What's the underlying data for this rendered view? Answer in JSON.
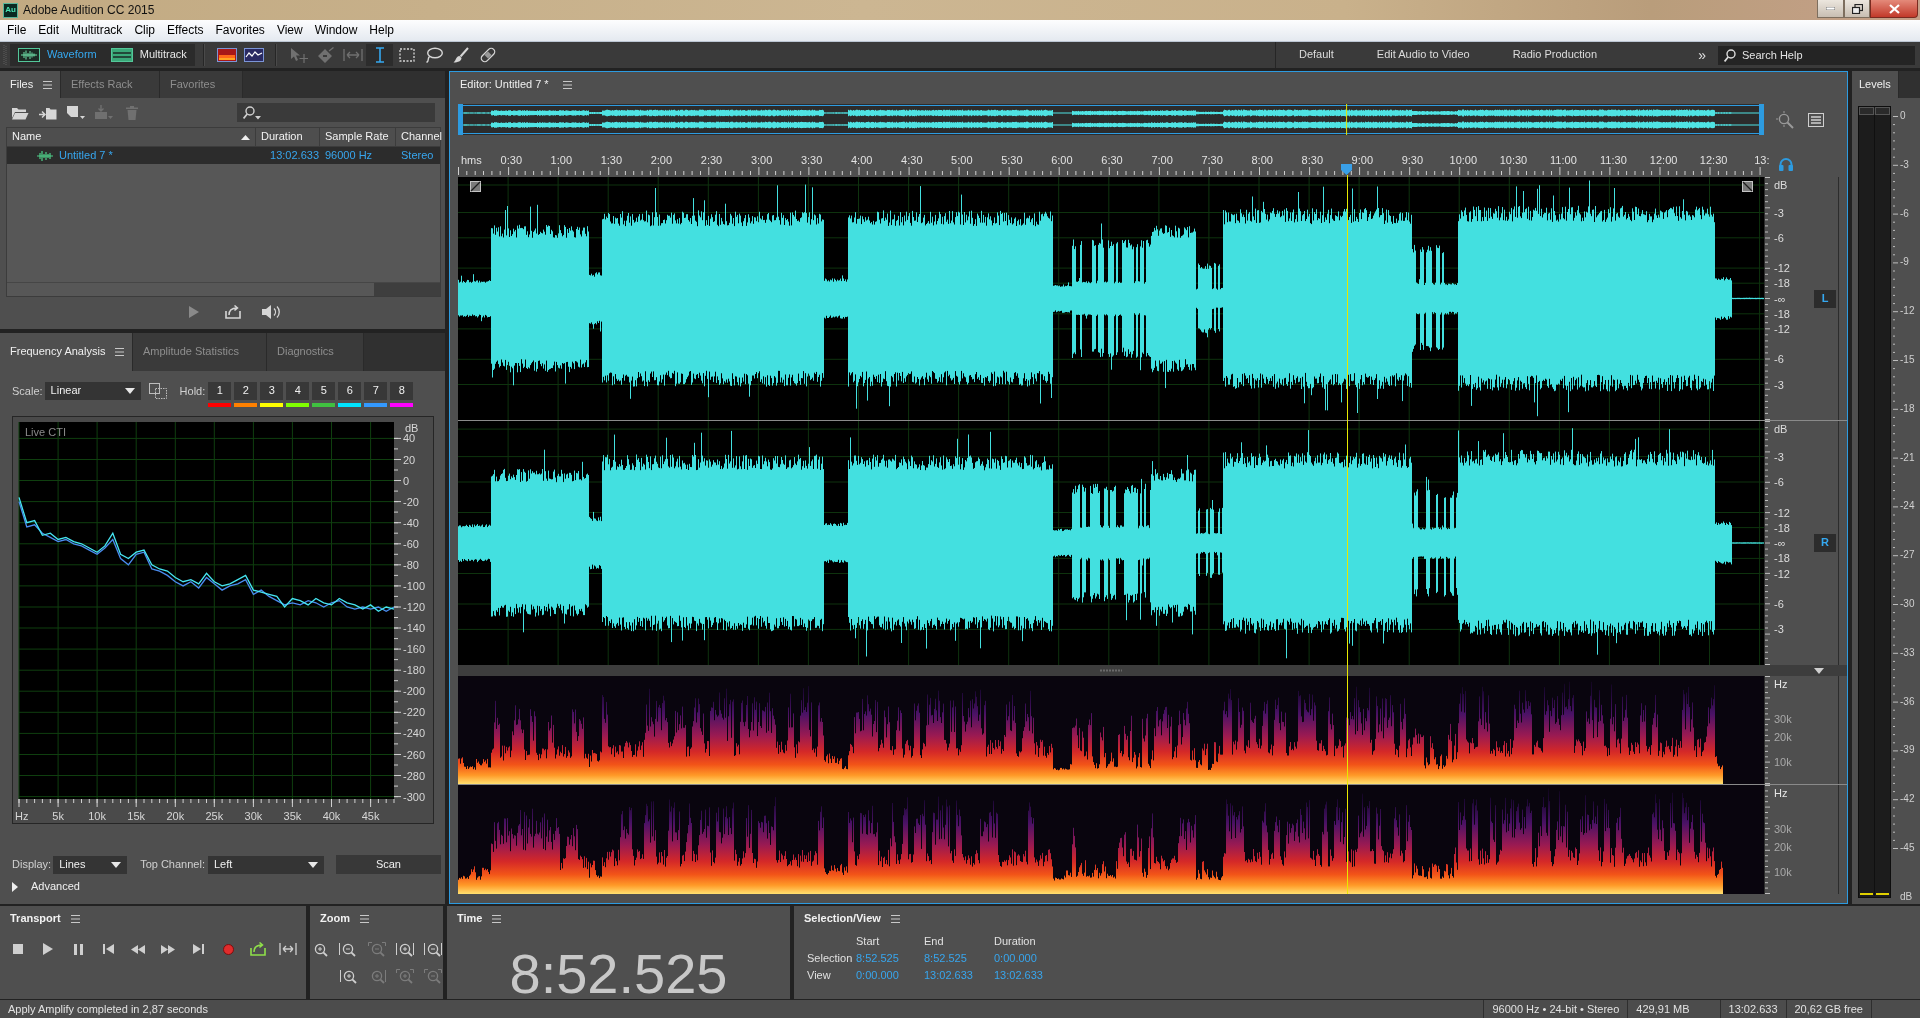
{
  "window": {
    "logo": "Au",
    "title": "Adobe Audition CC 2015"
  },
  "menu": [
    "File",
    "Edit",
    "Multitrack",
    "Clip",
    "Effects",
    "Favorites",
    "View",
    "Window",
    "Help"
  ],
  "toolbar": {
    "views": [
      {
        "kind": "waveform",
        "label": "Waveform",
        "selected": true
      },
      {
        "kind": "multitrack",
        "label": "Multitrack",
        "selected": false
      }
    ],
    "display_buttons": [
      {
        "kind": "spectral",
        "selected": false
      },
      {
        "kind": "pitch",
        "selected": false
      }
    ],
    "tools": [
      {
        "kind": "move",
        "selected": false,
        "disabled": true
      },
      {
        "kind": "razor",
        "selected": false,
        "disabled": true
      },
      {
        "kind": "slip",
        "selected": false,
        "disabled": true
      },
      {
        "kind": "time-selection",
        "selected": true,
        "disabled": false
      },
      {
        "kind": "marquee",
        "selected": false,
        "disabled": false
      },
      {
        "kind": "lasso",
        "selected": false,
        "disabled": false
      },
      {
        "kind": "brush",
        "selected": false,
        "disabled": false
      },
      {
        "kind": "healing",
        "selected": false,
        "disabled": false
      }
    ],
    "workspaces": [
      "Default",
      "Edit Audio to Video",
      "Radio Production"
    ],
    "overflow": "»",
    "search": {
      "placeholder": "Search Help"
    }
  },
  "files_panel": {
    "tabs": [
      {
        "label": "Files",
        "selected": true
      },
      {
        "label": "Effects Rack",
        "selected": false
      },
      {
        "label": "Favorites",
        "selected": false
      }
    ],
    "tools": [
      {
        "kind": "open",
        "disabled": false
      },
      {
        "kind": "import",
        "disabled": false
      },
      {
        "kind": "new",
        "disabled": false
      },
      {
        "kind": "insert",
        "disabled": true
      },
      {
        "kind": "delete",
        "disabled": true
      }
    ],
    "columns": [
      {
        "label": "Name",
        "sorted": true
      },
      {
        "label": "Duration",
        "sorted": false
      },
      {
        "label": "Sample Rate",
        "sorted": false
      },
      {
        "label": "Channel",
        "sorted": false
      }
    ],
    "rows": [
      {
        "name": "Untitled 7 *",
        "duration": "13:02.633",
        "sample_rate": "96000 Hz",
        "channel": "Stereo",
        "selected": true
      }
    ],
    "preview_buttons": [
      {
        "kind": "play",
        "disabled": true
      },
      {
        "kind": "loop",
        "disabled": false
      },
      {
        "kind": "autoplay",
        "disabled": false
      }
    ]
  },
  "analysis_panel": {
    "tabs": [
      {
        "label": "Frequency Analysis",
        "selected": true
      },
      {
        "label": "Amplitude Statistics",
        "selected": false
      },
      {
        "label": "Diagnostics",
        "selected": false
      }
    ],
    "scale_label": "Scale:",
    "scale": "Linear",
    "hold_label": "Hold:",
    "hold": [
      {
        "label": "1",
        "color": "#ff0000"
      },
      {
        "label": "2",
        "color": "#ff8000"
      },
      {
        "label": "3",
        "color": "#ffff00"
      },
      {
        "label": "4",
        "color": "#80ff00"
      },
      {
        "label": "5",
        "color": "#40c040"
      },
      {
        "label": "6",
        "color": "#00e5ff"
      },
      {
        "label": "7",
        "color": "#3399ff"
      },
      {
        "label": "8",
        "color": "#ff00ff"
      }
    ],
    "chart_data": {
      "type": "line",
      "title": "Live CTI",
      "ylabel": "dB",
      "x": [
        0,
        1000,
        2000,
        3000,
        4000,
        5000,
        6000,
        7000,
        8000,
        9000,
        10000,
        11000,
        12000,
        13000,
        14000,
        15000,
        16000,
        17000,
        18000,
        19000,
        20000,
        21000,
        22000,
        23000,
        24000,
        25000,
        26000,
        27000,
        28000,
        29000,
        30000,
        31000,
        32000,
        33000,
        34000,
        35000,
        36000,
        37000,
        38000,
        39000,
        40000,
        41000,
        42000,
        43000,
        44000,
        45000,
        46000,
        47000,
        48000
      ],
      "series": [
        {
          "color": "#4a8cf0",
          "values": [
            -20,
            -44,
            -42,
            -50,
            -54,
            -58,
            -56,
            -60,
            -62,
            -66,
            -70,
            -64,
            -56,
            -74,
            -80,
            -70,
            -68,
            -84,
            -86,
            -90,
            -96,
            -100,
            -96,
            -102,
            -92,
            -98,
            -104,
            -100,
            -98,
            -94,
            -108,
            -104,
            -110,
            -114,
            -118,
            -116,
            -118,
            -114,
            -116,
            -120,
            -116,
            -114,
            -120,
            -122,
            -120,
            -122,
            -120,
            -124,
            -120
          ]
        },
        {
          "color": "#46e6f2",
          "values": [
            -16,
            -40,
            -38,
            -52,
            -50,
            -56,
            -54,
            -58,
            -60,
            -64,
            -68,
            -62,
            -50,
            -70,
            -74,
            -68,
            -66,
            -80,
            -84,
            -86,
            -92,
            -96,
            -94,
            -98,
            -88,
            -96,
            -100,
            -98,
            -94,
            -90,
            -104,
            -106,
            -108,
            -110,
            -120,
            -112,
            -114,
            -118,
            -112,
            -116,
            -118,
            -112,
            -116,
            -118,
            -122,
            -118,
            -124,
            -120,
            -122
          ]
        }
      ],
      "xlim": [
        0,
        48000
      ],
      "ylim": [
        -300,
        40
      ],
      "xticks": [
        {
          "value": 0,
          "label": "Hz"
        },
        {
          "value": 5000,
          "label": "5k"
        },
        {
          "value": 10000,
          "label": "10k"
        },
        {
          "value": 15000,
          "label": "15k"
        },
        {
          "value": 20000,
          "label": "20k"
        },
        {
          "value": 25000,
          "label": "25k"
        },
        {
          "value": 30000,
          "label": "30k"
        },
        {
          "value": 35000,
          "label": "35k"
        },
        {
          "value": 40000,
          "label": "40k"
        },
        {
          "value": 45000,
          "label": "45k"
        }
      ],
      "yticks": [
        40,
        20,
        0,
        -20,
        -40,
        -60,
        -80,
        -100,
        -120,
        -140,
        -160,
        -180,
        -200,
        -220,
        -240,
        -260,
        -280,
        -300
      ],
      "grid": true
    },
    "display_label": "Display:",
    "display": "Lines",
    "top_channel_label": "Top Channel:",
    "top_channel": "Left",
    "scan_button": "Scan",
    "advanced": {
      "label": "Advanced",
      "expanded": false
    }
  },
  "editor": {
    "title": "Editor: Untitled 7 *",
    "ruler": [
      "hms",
      "0:30",
      "1:00",
      "1:30",
      "2:00",
      "2:30",
      "3:00",
      "3:30",
      "4:00",
      "4:30",
      "5:00",
      "5:30",
      "6:00",
      "6:30",
      "7:00",
      "7:30",
      "8:00",
      "8:30",
      "9:00",
      "9:30",
      "10:00",
      "10:30",
      "11:00",
      "11:30",
      "12:00",
      "12:30",
      "13:"
    ],
    "playhead": {
      "level": 0.6804
    },
    "channels": [
      {
        "label": "L",
        "scale": [
          "dB",
          "-3",
          "-6",
          "-12",
          "-18",
          "-∞",
          "-18",
          "-12",
          "-6",
          "-3"
        ]
      },
      {
        "label": "R",
        "scale": [
          "dB",
          "-3",
          "-6",
          "-12",
          "-18",
          "-∞",
          "-18",
          "-12",
          "-6",
          "-3"
        ]
      }
    ],
    "spectral": [
      {
        "scale": [
          "Hz",
          "30k",
          "20k",
          "10k"
        ]
      },
      {
        "scale": [
          "Hz",
          "30k",
          "20k",
          "10k"
        ]
      }
    ]
  },
  "levels_panel": {
    "tab": "Levels",
    "scale": [
      "0",
      "-3",
      "-6",
      "-9",
      "-12",
      "-15",
      "-18",
      "-21",
      "-24",
      "-27",
      "-30",
      "-33",
      "-36",
      "-39",
      "-42",
      "-45",
      "dB"
    ]
  },
  "transport": {
    "title": "Transport",
    "buttons": [
      {
        "kind": "stop",
        "on": false
      },
      {
        "kind": "play",
        "on": false
      },
      {
        "kind": "pause",
        "on": false
      },
      {
        "kind": "start",
        "on": false
      },
      {
        "kind": "rewind",
        "on": false
      },
      {
        "kind": "forward",
        "on": false
      },
      {
        "kind": "end",
        "on": false
      },
      {
        "kind": "record",
        "on": false
      },
      {
        "kind": "loop",
        "on": true
      },
      {
        "kind": "skip",
        "on": false
      }
    ]
  },
  "zoom": {
    "title": "Zoom",
    "button_rows": [
      [
        {
          "kind": "in-amplitude",
          "disabled": false
        },
        {
          "kind": "out-amplitude",
          "disabled": false
        },
        {
          "kind": "out-full",
          "disabled": true
        },
        {
          "kind": "in-time",
          "disabled": false
        },
        {
          "kind": "out-time",
          "disabled": false
        }
      ],
      [
        {
          "kind": "in-left",
          "disabled": false
        },
        {
          "kind": "in-right",
          "disabled": true
        },
        {
          "kind": "selection",
          "disabled": true
        },
        {
          "kind": "tracks",
          "disabled": true
        }
      ]
    ]
  },
  "time_panel": {
    "title": "Time",
    "value": "8:52.525"
  },
  "selection_panel": {
    "title": "Selection/View",
    "columns": [
      "Start",
      "End",
      "Duration"
    ],
    "rows": [
      {
        "label": "Selection",
        "values": [
          "8:52.525",
          "8:52.525",
          "0:00.000"
        ]
      },
      {
        "label": "View",
        "values": [
          "0:00.000",
          "13:02.633",
          "13:02.633"
        ]
      }
    ]
  },
  "status_bar": {
    "message": "Apply Amplify completed in 2,87 seconds",
    "format": "96000 Hz • 24-bit • Stereo",
    "size": "429,91 MB",
    "duration": "13:02.633",
    "free": "20,62 GB free"
  }
}
